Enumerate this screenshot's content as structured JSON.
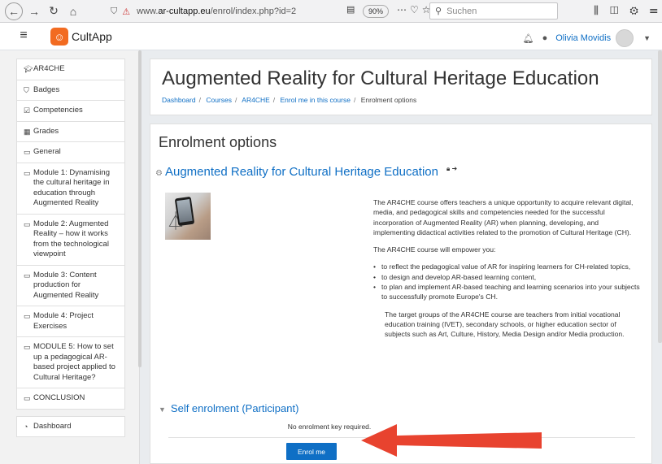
{
  "browser": {
    "url_prefix": "www.",
    "url_domain": "ar-cultapp.eu",
    "url_path": "/enrol/index.php?id=2",
    "zoom": "90%",
    "search_placeholder": "Suchen"
  },
  "navbar": {
    "brand": "CultApp",
    "user_name": "Olivia Movidis"
  },
  "drawer": {
    "items": [
      {
        "icon": "graduation-cap-icon",
        "label": "AR4CHE"
      },
      {
        "icon": "shield-icon",
        "label": "Badges"
      },
      {
        "icon": "checkbox-icon",
        "label": "Competencies"
      },
      {
        "icon": "table-icon",
        "label": "Grades"
      },
      {
        "icon": "folder-icon",
        "label": "General"
      },
      {
        "icon": "folder-icon",
        "label": "Module 1: Dynamising the cultural heritage in education through Augmented Reality"
      },
      {
        "icon": "folder-icon",
        "label": "Module 2: Augmented Reality – how it works from the technological viewpoint"
      },
      {
        "icon": "folder-icon",
        "label": "Module 3: Content production for Augmented Reality"
      },
      {
        "icon": "folder-icon",
        "label": "Module 4: Project Exercises"
      },
      {
        "icon": "folder-icon",
        "label": "MODULE 5: How to set up a pedagogical AR-based project applied to Cultural Heritage?"
      },
      {
        "icon": "folder-icon",
        "label": "CONCLUSION"
      }
    ],
    "dashboard": {
      "icon": "dashboard-icon",
      "label": "Dashboard"
    }
  },
  "header": {
    "title": "Augmented Reality for Cultural Heritage Education",
    "breadcrumb": [
      "Dashboard",
      "Courses",
      "AR4CHE",
      "Enrol me in this course",
      "Enrolment options"
    ]
  },
  "main": {
    "heading": "Enrolment options",
    "course_name": "Augmented Reality for Cultural Heritage Education",
    "summary_p1": "The AR4CHE course offers teachers a unique opportunity to acquire relevant digital, media, and pedagogical skills and competencies needed for the successful incorporation of Augmented Reality (AR) when planning, developing, and implementing didactical activities related to the promotion of Cultural Heritage (CH).",
    "summary_p2": "The AR4CHE course will empower you:",
    "bullets": [
      "to reflect the pedagogical value of AR for inspiring learners for CH-related topics,",
      "to design and develop AR-based learning content,",
      "to plan and implement AR-based teaching and learning scenarios into your subjects to successfully promote Europe's CH."
    ],
    "summary_p3": "The target groups of the AR4CHE course are teachers from initial vocational education training (IVET), secondary schools, or higher education sector of subjects such as Art, Culture, History, Media Design and/or Media production.",
    "self_enrol_title": "Self enrolment (Participant)",
    "no_key_text": "No enrolment key required.",
    "enrol_button": "Enrol me"
  },
  "colors": {
    "link": "#0f6fc5",
    "button": "#0f6fc5",
    "arrow": "#e8432f",
    "logo": "#f26b21"
  }
}
